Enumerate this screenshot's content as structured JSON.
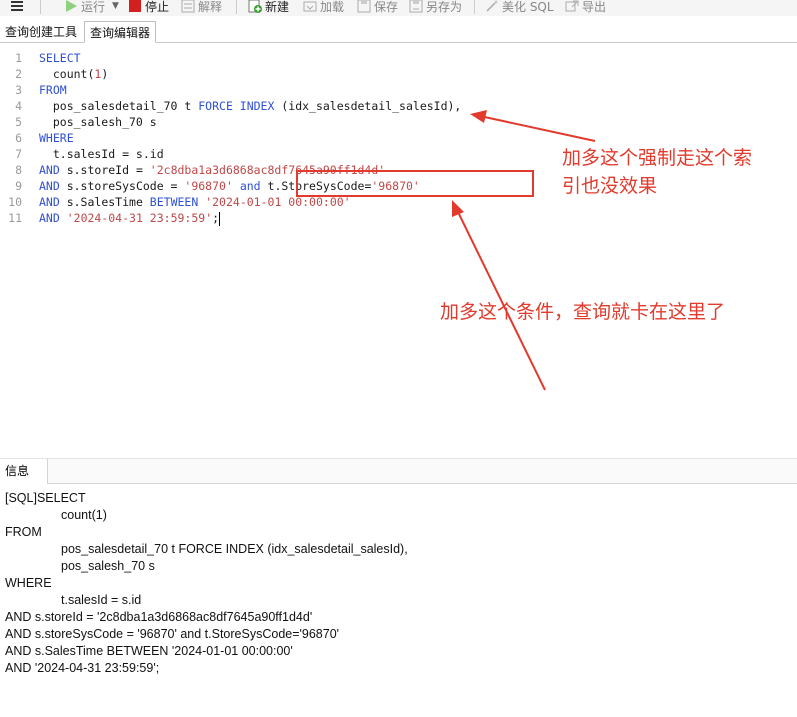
{
  "toolbar": {
    "items": [
      {
        "label": "运行",
        "icon": "play-icon"
      },
      {
        "label": "停止",
        "icon": "stop-icon"
      },
      {
        "label": "解释",
        "icon": "explain-icon"
      },
      {
        "label": "新建",
        "icon": "new-icon"
      },
      {
        "label": "加载",
        "icon": "load-icon"
      },
      {
        "label": "保存",
        "icon": "save-icon"
      },
      {
        "label": "另存为",
        "icon": "save-as-icon"
      },
      {
        "label": "美化 SQL",
        "icon": "beautify-icon"
      },
      {
        "label": "导出",
        "icon": "export-icon"
      }
    ],
    "colors": {
      "run": "#7cc36a",
      "stop": "#d21f1f",
      "new": "#3a9a2e"
    }
  },
  "tabs": [
    {
      "label": "查询创建工具"
    },
    {
      "label": "查询编辑器"
    }
  ],
  "editor": {
    "line_numbers": [
      "1",
      "2",
      "3",
      "4",
      "5",
      "6",
      "7",
      "8",
      "9",
      "10",
      "11"
    ],
    "lines": [
      [
        {
          "t": "SELECT",
          "c": "kw"
        }
      ],
      [
        {
          "t": "  count",
          "c": "fn"
        },
        {
          "t": "(",
          "c": "plain"
        },
        {
          "t": "1",
          "c": "num"
        },
        {
          "t": ")",
          "c": "plain"
        }
      ],
      [
        {
          "t": "FROM",
          "c": "kw"
        }
      ],
      [
        {
          "t": "  pos_salesdetail_70 t ",
          "c": "plain"
        },
        {
          "t": "FORCE INDEX",
          "c": "kw"
        },
        {
          "t": " (idx_salesdetail_salesId),",
          "c": "plain"
        }
      ],
      [
        {
          "t": "  pos_salesh_70 s",
          "c": "plain"
        }
      ],
      [
        {
          "t": "WHERE",
          "c": "kw"
        }
      ],
      [
        {
          "t": "  t.salesId = s.id",
          "c": "plain"
        }
      ],
      [
        {
          "t": "AND",
          "c": "kw"
        },
        {
          "t": " s.storeId = ",
          "c": "plain"
        },
        {
          "t": "'2c8dba1a3d6868ac8df7645a90ff1d4d'",
          "c": "str"
        }
      ],
      [
        {
          "t": "AND",
          "c": "kw"
        },
        {
          "t": " s.storeSysCode = ",
          "c": "plain"
        },
        {
          "t": "'96870'",
          "c": "str"
        },
        {
          "t": " ",
          "c": "plain"
        },
        {
          "t": "and",
          "c": "kw"
        },
        {
          "t": " t.StoreSysCode=",
          "c": "plain"
        },
        {
          "t": "'96870'",
          "c": "str"
        }
      ],
      [
        {
          "t": "AND",
          "c": "kw"
        },
        {
          "t": " s.SalesTime ",
          "c": "plain"
        },
        {
          "t": "BETWEEN",
          "c": "kw"
        },
        {
          "t": " ",
          "c": "plain"
        },
        {
          "t": "'2024-01-01 00:00:00'",
          "c": "str"
        }
      ],
      [
        {
          "t": "AND",
          "c": "kw"
        },
        {
          "t": " ",
          "c": "plain"
        },
        {
          "t": "'2024-04-31 23:59:59'",
          "c": "str"
        },
        {
          "t": ";",
          "c": "plain"
        }
      ]
    ]
  },
  "annotations": {
    "note1_line1": "加多这个强制走这个索",
    "note1_line2": "引也没效果",
    "note2": "加多这个条件，查询就卡在这里了",
    "color": "#e23a2c"
  },
  "info": {
    "tab_label": "信息",
    "lines": [
      "[SQL]SELECT",
      "count(1)",
      "FROM",
      "pos_salesdetail_70 t FORCE INDEX (idx_salesdetail_salesId),",
      "pos_salesh_70 s",
      "WHERE",
      "t.salesId = s.id",
      "AND s.storeId = '2c8dba1a3d6868ac8df7645a90ff1d4d'",
      "AND s.storeSysCode = '96870' and t.StoreSysCode='96870'",
      "AND s.SalesTime BETWEEN '2024-01-01 00:00:00'",
      "AND '2024-04-31 23:59:59';"
    ]
  }
}
